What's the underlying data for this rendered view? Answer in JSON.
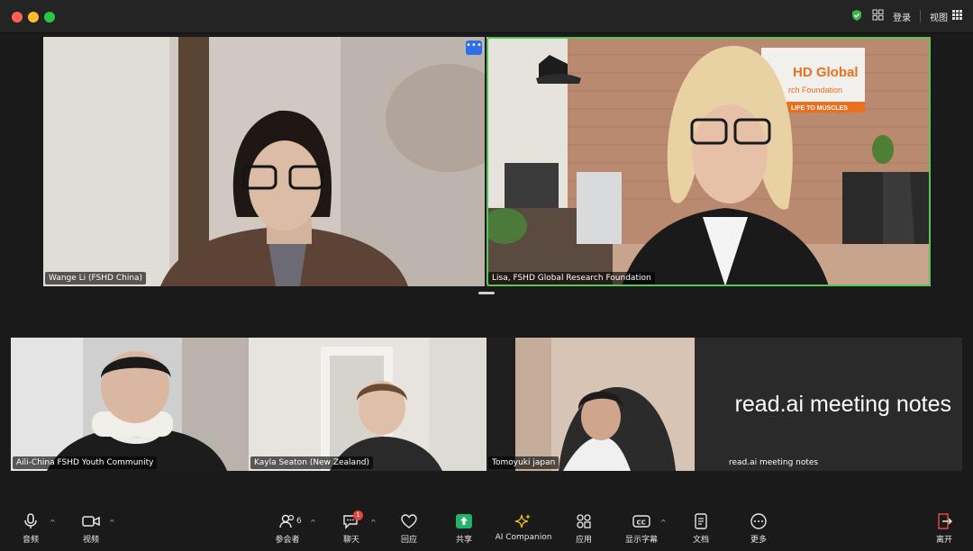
{
  "titlebar": {
    "login_label": "登录",
    "view_label": "视图",
    "icons": [
      "shield-check-icon",
      "grid-icon",
      "gallery-view-icon"
    ]
  },
  "colors": {
    "active_speaker": "#58c55a",
    "share_button": "#23b26a",
    "more_button": "#2d6fe6",
    "leave_icon": "#e3463d",
    "chat_badge": "#e3463d"
  },
  "participants": [
    {
      "name": "Wange Li (FSHD China)"
    },
    {
      "name": "Lisa, FSHD Global Research Foundation"
    },
    {
      "name": "Aili-China FSHD Youth Community"
    },
    {
      "name": "Kayla Seaton (New Zealand)"
    },
    {
      "name": "Tomoyuki japan"
    },
    {
      "name": "read.ai meeting notes",
      "display_text": "read.ai meeting notes"
    }
  ],
  "backdrop": {
    "sign_line1": "HD Global",
    "sign_line2": "rch Foundation",
    "sign_line3": "LIFE TO MUSCLES"
  },
  "toolbar": {
    "audio": "音频",
    "video": "视频",
    "participants": "参会者",
    "participants_count": "6",
    "chat": "聊天",
    "chat_badge": "1",
    "reactions": "回应",
    "share": "共享",
    "ai_companion": "AI Companion",
    "apps": "应用",
    "captions": "显示字幕",
    "docs": "文档",
    "more": "更多",
    "leave": "离开"
  }
}
